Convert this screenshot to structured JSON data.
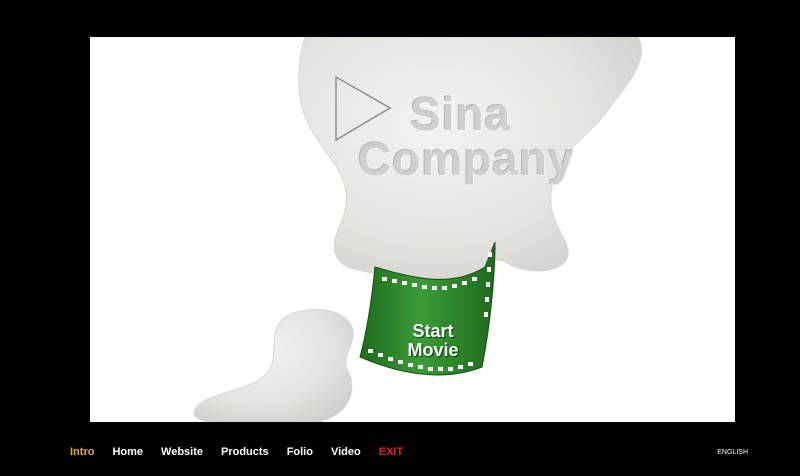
{
  "brand": {
    "line1": "Sina",
    "line2": "Company",
    "logo_icon": "play-triangle-icon"
  },
  "film": {
    "label_line1": "Start",
    "label_line2": "Movie",
    "color": "#2e8a2c"
  },
  "nav": {
    "items": [
      {
        "label": "Intro",
        "state": "active",
        "color": "#e2a640"
      },
      {
        "label": "Home"
      },
      {
        "label": "Website"
      },
      {
        "label": "Products"
      },
      {
        "label": "Folio"
      },
      {
        "label": "Video"
      },
      {
        "label": "EXIT",
        "color": "#e0201c"
      }
    ],
    "language": "ENGLISH"
  }
}
